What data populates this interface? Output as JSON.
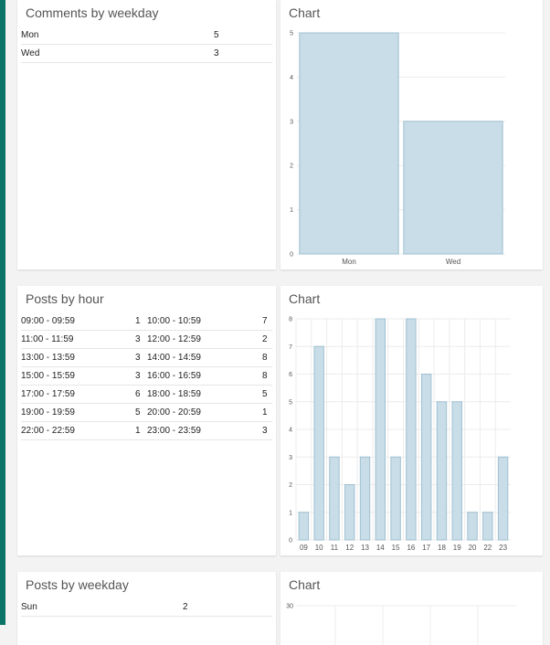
{
  "colors": {
    "accent": "#0b7466",
    "bar_fill": "#c8dde7",
    "bar_stroke": "#9fc0d1"
  },
  "comments_by_weekday": {
    "title": "Comments by weekday",
    "rows": [
      {
        "day": "Mon",
        "count": "5"
      },
      {
        "day": "Wed",
        "count": "3"
      }
    ]
  },
  "chart1": {
    "title": "Chart"
  },
  "posts_by_hour": {
    "title": "Posts by hour",
    "rows": [
      {
        "range_a": "09:00 - 09:59",
        "count_a": "1",
        "range_b": "10:00 - 10:59",
        "count_b": "7"
      },
      {
        "range_a": "11:00 - 11:59",
        "count_a": "3",
        "range_b": "12:00 - 12:59",
        "count_b": "2"
      },
      {
        "range_a": "13:00 - 13:59",
        "count_a": "3",
        "range_b": "14:00 - 14:59",
        "count_b": "8"
      },
      {
        "range_a": "15:00 - 15:59",
        "count_a": "3",
        "range_b": "16:00 - 16:59",
        "count_b": "8"
      },
      {
        "range_a": "17:00 - 17:59",
        "count_a": "6",
        "range_b": "18:00 - 18:59",
        "count_b": "5"
      },
      {
        "range_a": "19:00 - 19:59",
        "count_a": "5",
        "range_b": "20:00 - 20:59",
        "count_b": "1"
      },
      {
        "range_a": "22:00 - 22:59",
        "count_a": "1",
        "range_b": "23:00 - 23:59",
        "count_b": "3"
      }
    ]
  },
  "chart2": {
    "title": "Chart"
  },
  "posts_by_weekday": {
    "title": "Posts by weekday",
    "rows": [
      {
        "day": "Sun",
        "count": "2"
      }
    ]
  },
  "chart3": {
    "title": "Chart"
  },
  "chart_data": [
    {
      "type": "bar",
      "categories": [
        "Mon",
        "Wed"
      ],
      "values": [
        5,
        3
      ],
      "title": "",
      "xlabel": "",
      "ylabel": "",
      "ylim": [
        0,
        5
      ],
      "yticks": [
        "0",
        "1",
        "2",
        "3",
        "4",
        "5"
      ],
      "grid": true
    },
    {
      "type": "bar",
      "categories": [
        "09",
        "10",
        "11",
        "12",
        "13",
        "14",
        "15",
        "16",
        "17",
        "18",
        "19",
        "20",
        "22",
        "23"
      ],
      "values": [
        1,
        7,
        3,
        2,
        3,
        8,
        3,
        8,
        6,
        5,
        5,
        1,
        1,
        3
      ],
      "title": "",
      "xlabel": "",
      "ylabel": "",
      "ylim": [
        0,
        8
      ],
      "yticks": [
        "0",
        "1",
        "2",
        "3",
        "4",
        "5",
        "6",
        "7",
        "8"
      ],
      "grid": true
    },
    {
      "type": "bar",
      "categories": [],
      "values": [],
      "title": "",
      "xlabel": "",
      "ylabel": "",
      "yticks": [
        "30"
      ],
      "grid": true
    }
  ]
}
